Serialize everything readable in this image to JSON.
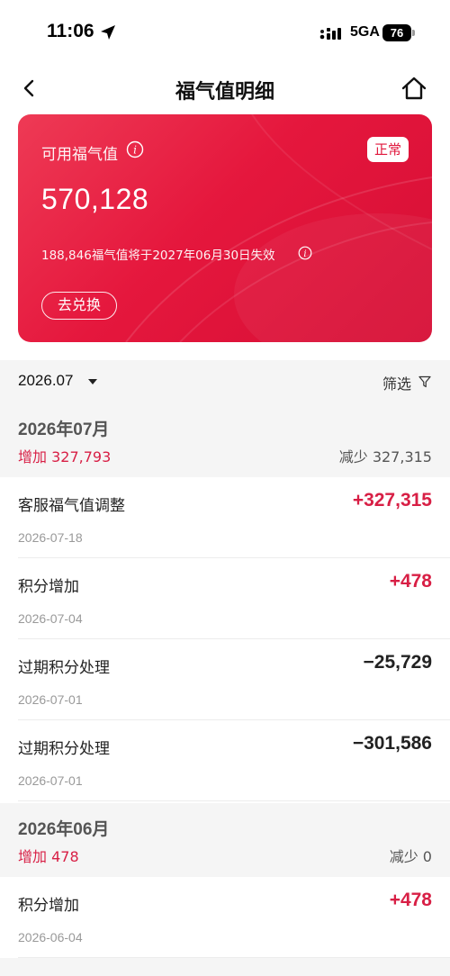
{
  "status_bar": {
    "time": "11:06",
    "network": "5GA",
    "battery": "76"
  },
  "nav": {
    "title": "福气值明细"
  },
  "card": {
    "label": "可用福气值",
    "status": "正常",
    "amount": "570,128",
    "expire_note": "188,846福气值将于2027年06月30日失效",
    "exchange_button": "去兑换",
    "colors": {
      "start": "#ee3a55",
      "end": "#d60e35"
    }
  },
  "filter": {
    "month": "2026.07",
    "filter_label": "筛选"
  },
  "months": [
    {
      "title": "2026年07月",
      "increase": "增加 327,793",
      "decrease": "减少 327,315",
      "records": [
        {
          "title": "客服福气值调整",
          "amount": "+327,315",
          "date": "2026-07-18"
        },
        {
          "title": "积分增加",
          "amount": "+478",
          "date": "2026-07-04"
        },
        {
          "title": "过期积分处理",
          "amount": "−25,729",
          "date": "2026-07-01"
        },
        {
          "title": "过期积分处理",
          "amount": "−301,586",
          "date": "2026-07-01"
        }
      ]
    },
    {
      "title": "2026年06月",
      "increase": "增加 478",
      "decrease": "减少 0",
      "records": [
        {
          "title": "积分增加",
          "amount": "+478",
          "date": "2026-06-04"
        }
      ]
    }
  ],
  "colors": {
    "accent": "#d81f45",
    "section_bg": "#f5f5f5"
  }
}
